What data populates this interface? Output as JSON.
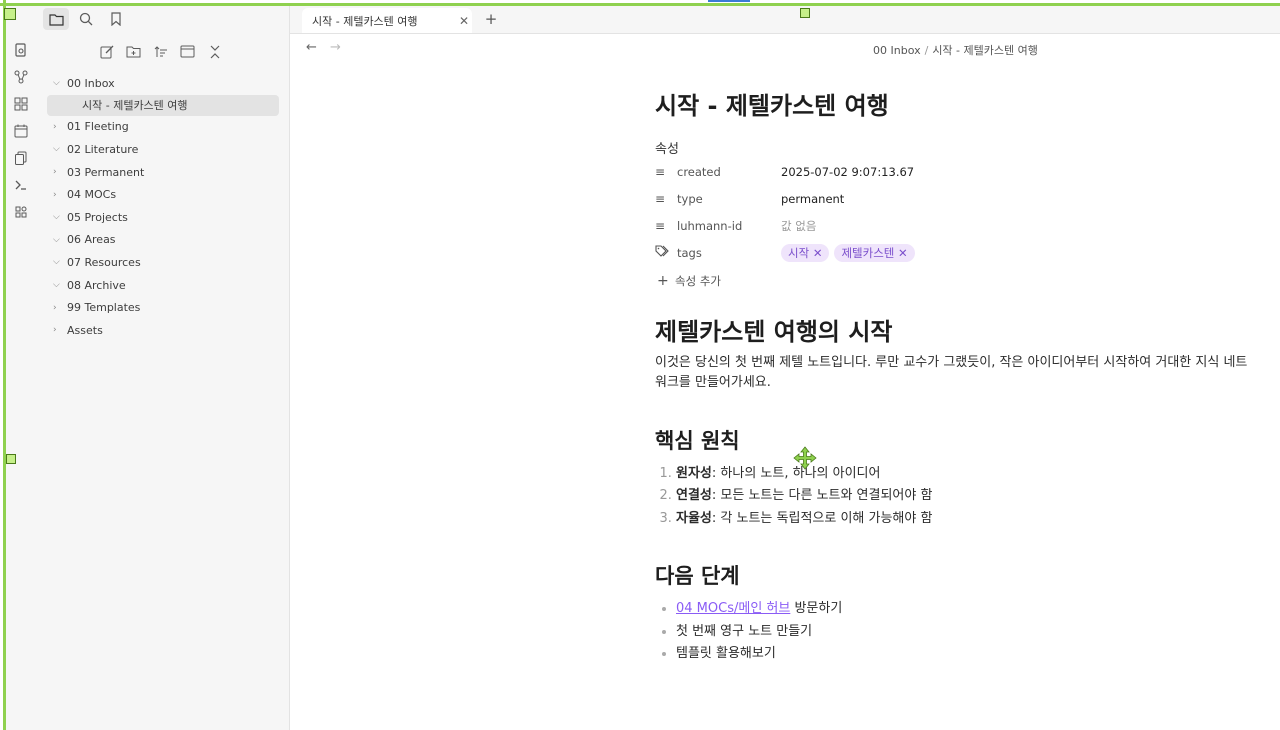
{
  "tab": {
    "title": "시작 - 제텔카스텐 여행"
  },
  "breadcrumb": {
    "folder": "00 Inbox",
    "separator": "/",
    "file": "시작 - 제텔카스텐 여행"
  },
  "tree": {
    "items": [
      {
        "label": "00 Inbox",
        "expanded": true
      },
      {
        "label": "시작 - 제텔카스텐 여행",
        "child": true
      },
      {
        "label": "01 Fleeting",
        "expanded": false
      },
      {
        "label": "02 Literature",
        "expanded": true
      },
      {
        "label": "03 Permanent",
        "expanded": false
      },
      {
        "label": "04 MOCs",
        "expanded": false
      },
      {
        "label": "05 Projects",
        "expanded": true
      },
      {
        "label": "06 Areas",
        "expanded": true
      },
      {
        "label": "07 Resources",
        "expanded": true
      },
      {
        "label": "08 Archive",
        "expanded": true
      },
      {
        "label": "99 Templates",
        "expanded": false
      },
      {
        "label": "Assets",
        "expanded": false
      }
    ]
  },
  "note": {
    "title": "시작 - 제텔카스텐 여행",
    "properties_heading": "속성",
    "properties": [
      {
        "name": "created",
        "value": "2025-07-02  9:07:13.67"
      },
      {
        "name": "type",
        "value": "permanent"
      },
      {
        "name": "luhmann-id",
        "value": "값 없음"
      },
      {
        "name": "tags",
        "tags": [
          "시작",
          "제텔카스텐"
        ]
      }
    ],
    "add_property": "속성 추가",
    "h2": "제텔카스텐 여행의 시작",
    "intro": "이것은 당신의 첫 번째 제텔 노트입니다. 루만 교수가 그랬듯이, 작은 아이디어부터 시작하여 거대한 지식 네트워크를 만들어가세요.",
    "principles_heading": "핵심 원칙",
    "principles": [
      {
        "term": "원자성",
        "desc": " 하나의 노트, 하나의 아이디어"
      },
      {
        "term": "연결성",
        "desc": " 모든 노트는 다른 노트와 연결되어야 함"
      },
      {
        "term": "자율성",
        "desc": " 각 노트는 독립적으로 이해 가능해야 함"
      }
    ],
    "next_heading": "다음 단계",
    "next_link": "04 MOCs/메인 허브",
    "next_link_suffix": " 방문하기",
    "next_items": [
      "첫 번째 영구 노트 만들기",
      "템플릿 활용해보기"
    ]
  },
  "colors": {
    "accent": "#8a5cf5",
    "tag_bg": "#efe4fb",
    "frame": "#8fd14f"
  }
}
